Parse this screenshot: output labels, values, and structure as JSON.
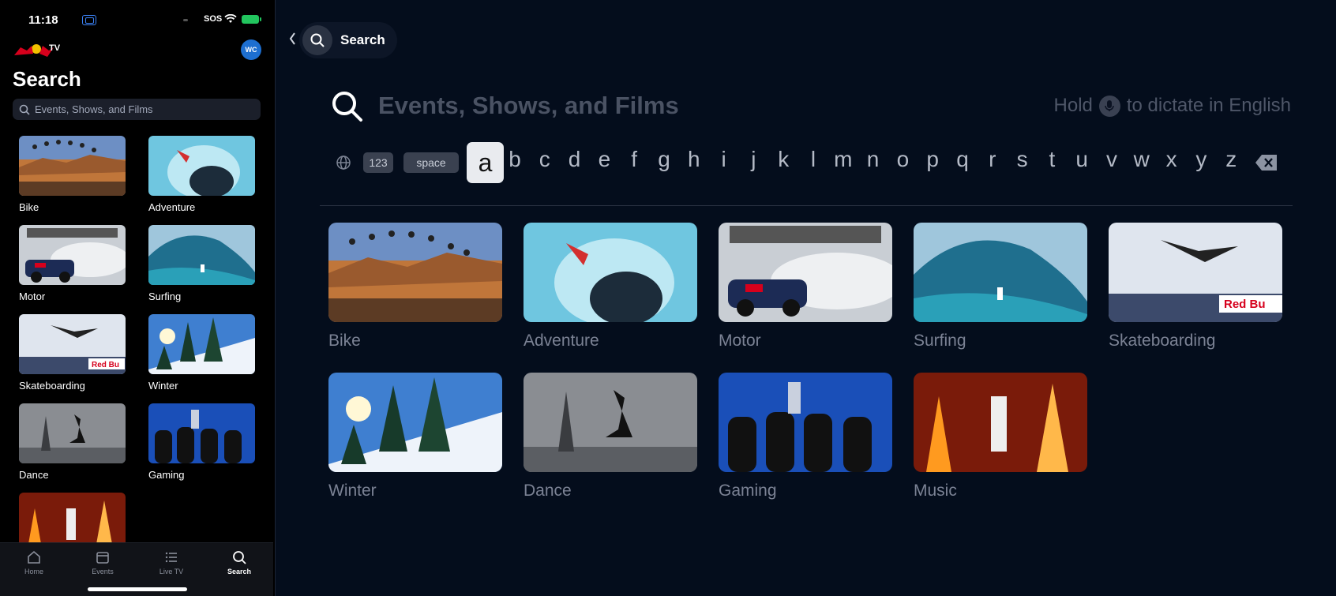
{
  "phone": {
    "status": {
      "time": "11:18",
      "sos": "SOS"
    },
    "avatar_initials": "WC",
    "title": "Search",
    "search_placeholder": "Events, Shows, and Films",
    "categories": [
      {
        "label": "Bike",
        "icon": "bike-thumbnail"
      },
      {
        "label": "Adventure",
        "icon": "adventure-thumbnail"
      },
      {
        "label": "Motor",
        "icon": "motor-thumbnail"
      },
      {
        "label": "Surfing",
        "icon": "surfing-thumbnail"
      },
      {
        "label": "Skateboarding",
        "icon": "skateboarding-thumbnail"
      },
      {
        "label": "Winter",
        "icon": "winter-thumbnail"
      },
      {
        "label": "Dance",
        "icon": "dance-thumbnail"
      },
      {
        "label": "Gaming",
        "icon": "gaming-thumbnail"
      },
      {
        "label": "",
        "icon": "music-thumbnail"
      }
    ],
    "tabs": [
      {
        "label": "Home",
        "icon": "home-icon"
      },
      {
        "label": "Events",
        "icon": "calendar-icon"
      },
      {
        "label": "Live TV",
        "icon": "list-icon"
      },
      {
        "label": "Search",
        "icon": "search-icon",
        "active": true
      }
    ]
  },
  "tv": {
    "search_pill_label": "Search",
    "query_placeholder": "Events, Shows, and Films",
    "dictate_prefix": "Hold",
    "dictate_suffix": "to dictate in English",
    "keyboard": {
      "numbers_key": "123",
      "space_key": "space",
      "selected_letter": "a",
      "letters": [
        "b",
        "c",
        "d",
        "e",
        "f",
        "g",
        "h",
        "i",
        "j",
        "k",
        "l",
        "m",
        "n",
        "o",
        "p",
        "q",
        "r",
        "s",
        "t",
        "u",
        "v",
        "w",
        "x",
        "y",
        "z"
      ]
    },
    "categories": [
      {
        "label": "Bike"
      },
      {
        "label": "Adventure"
      },
      {
        "label": "Motor"
      },
      {
        "label": "Surfing"
      },
      {
        "label": "Skateboarding"
      },
      {
        "label": "Winter"
      },
      {
        "label": "Dance"
      },
      {
        "label": "Gaming"
      },
      {
        "label": "Music"
      }
    ]
  },
  "colors": {
    "tv_background": "#040d1c",
    "phone_background": "#000000",
    "accent_blue": "#1d6fd1",
    "battery_green": "#22c55e"
  }
}
